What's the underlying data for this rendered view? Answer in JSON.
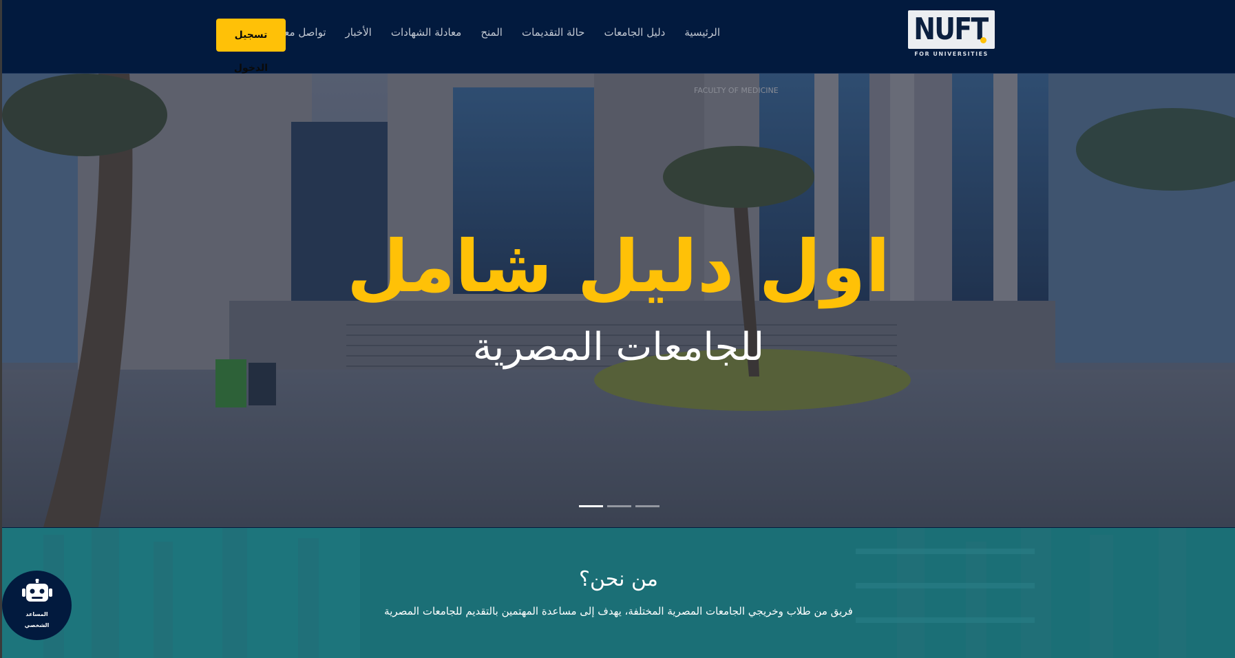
{
  "logo": {
    "text": "NUFT",
    "tagline": "FOR UNIVERSITIES",
    "accent_color": "#ffc107"
  },
  "nav": {
    "items": [
      {
        "label": "الرئيسية"
      },
      {
        "label": "دليل الجامعات"
      },
      {
        "label": "حالة التقديمات"
      },
      {
        "label": "المنح"
      },
      {
        "label": "معادلة الشهادات"
      },
      {
        "label": "الأخبار"
      },
      {
        "label": "تواصل معنا"
      }
    ],
    "login_label": "تسجيل الدخول"
  },
  "hero": {
    "title": "اول دليل شامل",
    "subtitle": "للجامعات المصرية",
    "slides_count": 3,
    "active_slide": 1
  },
  "about": {
    "title": "من نحن؟",
    "text": "فريق من طلاب وخريجي الجامعات المصرية المختلفة، يهدف إلى مساعدة المهتمين بالتقديم للجامعات المصرية"
  },
  "chatbot": {
    "icon": "robot-icon",
    "line1": "المساعد",
    "line2": "الشخصي"
  },
  "colors": {
    "navbar": "#021a3e",
    "accent": "#ffc107",
    "about_bg": "#1b6f76"
  }
}
